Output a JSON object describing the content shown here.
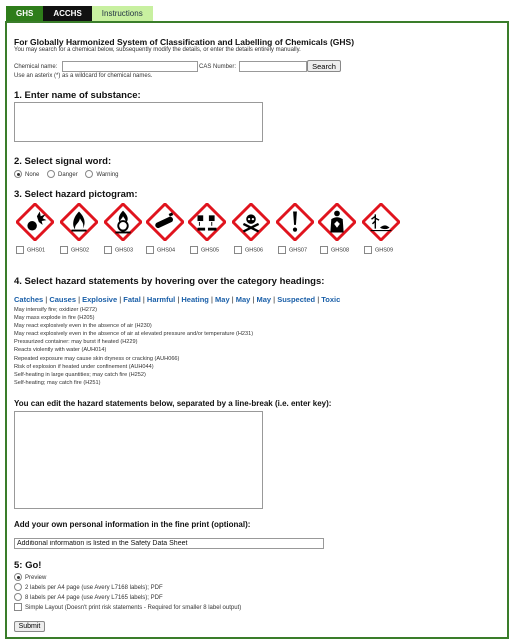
{
  "tabs": {
    "ghs": "GHS",
    "acchs": "ACCHS",
    "instructions": "Instructions"
  },
  "header": {
    "title": "For Globally Harmonized System of Classification and Labelling of Chemicals (GHS)",
    "subtitle": "You may search for a chemical below, subsequently modify the details, or enter the details entirely manually."
  },
  "search": {
    "chemical_label": "Chemical name:",
    "cas_label": "CAS Number:",
    "button": "Search",
    "wildcard_hint": "Use an asterix (*) as a wildcard for chemical names."
  },
  "step1": {
    "heading": "1. Enter name of substance:"
  },
  "step2": {
    "heading": "2. Select signal word:",
    "options": [
      "None",
      "Danger",
      "Warning"
    ],
    "selected": "None"
  },
  "step3": {
    "heading": "3. Select hazard pictogram:",
    "pictograms": [
      {
        "code": "GHS01",
        "icon": "exploding-bomb-icon"
      },
      {
        "code": "GHS02",
        "icon": "flame-icon"
      },
      {
        "code": "GHS03",
        "icon": "flame-over-circle-icon"
      },
      {
        "code": "GHS04",
        "icon": "gas-cylinder-icon"
      },
      {
        "code": "GHS05",
        "icon": "corrosion-icon"
      },
      {
        "code": "GHS06",
        "icon": "skull-crossbones-icon"
      },
      {
        "code": "GHS07",
        "icon": "exclamation-mark-icon"
      },
      {
        "code": "GHS08",
        "icon": "health-hazard-icon"
      },
      {
        "code": "GHS09",
        "icon": "environment-icon"
      }
    ]
  },
  "step4": {
    "heading": "4. Select hazard statements by hovering over the category headings:",
    "categories": [
      "Catches",
      "Causes",
      "Explosive",
      "Fatal",
      "Harmful",
      "Heating",
      "May",
      "May",
      "May",
      "Suspected",
      "Toxic"
    ],
    "statements": [
      "May intensify fire; oxidizer (H272)",
      "May mass explode in fire (H205)",
      "May react explosively even in the absence of air (H230)",
      "May react explosively even in the absence of air at elevated pressure and/or temperature (H231)",
      "Pressurized container: may burst if heated (H229)",
      "Reacts violently with water (AUH014)",
      "Repeated exposure may cause skin dryness or cracking (AUH066)",
      "Risk of explosion if heated under confinement (AUH044)",
      "Self-heating in large quantities; may catch fire (H252)",
      "Self-heating; may catch fire (H251)"
    ]
  },
  "edit": {
    "heading": "You can edit the hazard statements below, separated by a line-break (i.e. enter key):"
  },
  "personal": {
    "heading": "Add your own personal information in the fine print (optional):",
    "value": "Additional information is listed in the Safety Data Sheet"
  },
  "step5": {
    "heading": "5: Go!",
    "options": [
      "Preview",
      "2 labels per A4 page (use Avery L7168 labels); PDF",
      "8 labels per A4 page (use Avery L7165 labels); PDF"
    ],
    "simple_layout": "Simple Layout (Doesn't print risk statements - Required for smaller 8 label output)",
    "submit": "Submit"
  },
  "colors": {
    "tab_active": "#2e7d1a",
    "tab_dark": "#111111",
    "tab_light": "#c8f0a0",
    "link": "#1a5fa8",
    "pictogram_border": "#e0141e"
  }
}
